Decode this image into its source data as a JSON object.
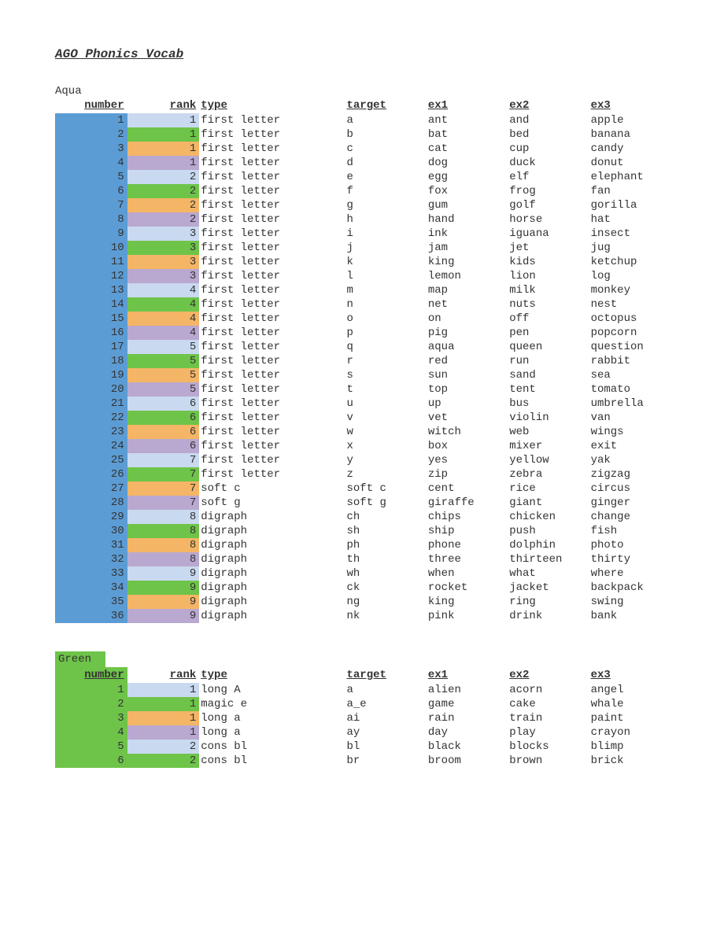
{
  "title": "AGO Phonics Vocab",
  "sections": [
    {
      "label": "Aqua",
      "num_bg_class": "aqua-bg",
      "headers": [
        "number",
        "rank",
        "type",
        "target",
        "ex1",
        "ex2",
        "ex3"
      ],
      "rows": [
        {
          "n": 1,
          "r": 1,
          "rc": "rank-c1",
          "type": "first letter",
          "target": "a",
          "ex1": "ant",
          "ex2": "and",
          "ex3": "apple"
        },
        {
          "n": 2,
          "r": 1,
          "rc": "rank-c2",
          "type": "first letter",
          "target": "b",
          "ex1": "bat",
          "ex2": "bed",
          "ex3": "banana"
        },
        {
          "n": 3,
          "r": 1,
          "rc": "rank-c3",
          "type": "first letter",
          "target": "c",
          "ex1": "cat",
          "ex2": "cup",
          "ex3": "candy"
        },
        {
          "n": 4,
          "r": 1,
          "rc": "rank-c4",
          "type": "first letter",
          "target": "d",
          "ex1": "dog",
          "ex2": "duck",
          "ex3": "donut"
        },
        {
          "n": 5,
          "r": 2,
          "rc": "rank-c1",
          "type": "first letter",
          "target": "e",
          "ex1": "egg",
          "ex2": "elf",
          "ex3": "elephant"
        },
        {
          "n": 6,
          "r": 2,
          "rc": "rank-c2",
          "type": "first letter",
          "target": "f",
          "ex1": "fox",
          "ex2": "frog",
          "ex3": "fan"
        },
        {
          "n": 7,
          "r": 2,
          "rc": "rank-c3",
          "type": "first letter",
          "target": "g",
          "ex1": "gum",
          "ex2": "golf",
          "ex3": "gorilla"
        },
        {
          "n": 8,
          "r": 2,
          "rc": "rank-c4",
          "type": "first letter",
          "target": "h",
          "ex1": "hand",
          "ex2": "horse",
          "ex3": "hat"
        },
        {
          "n": 9,
          "r": 3,
          "rc": "rank-c1",
          "type": "first letter",
          "target": "i",
          "ex1": "ink",
          "ex2": "iguana",
          "ex3": "insect"
        },
        {
          "n": 10,
          "r": 3,
          "rc": "rank-c2",
          "type": "first letter",
          "target": "j",
          "ex1": "jam",
          "ex2": "jet",
          "ex3": "jug"
        },
        {
          "n": 11,
          "r": 3,
          "rc": "rank-c3",
          "type": "first letter",
          "target": "k",
          "ex1": "king",
          "ex2": "kids",
          "ex3": "ketchup"
        },
        {
          "n": 12,
          "r": 3,
          "rc": "rank-c4",
          "type": "first letter",
          "target": "l",
          "ex1": "lemon",
          "ex2": "lion",
          "ex3": "log"
        },
        {
          "n": 13,
          "r": 4,
          "rc": "rank-c1",
          "type": "first letter",
          "target": "m",
          "ex1": "map",
          "ex2": "milk",
          "ex3": "monkey"
        },
        {
          "n": 14,
          "r": 4,
          "rc": "rank-c2",
          "type": "first letter",
          "target": "n",
          "ex1": "net",
          "ex2": "nuts",
          "ex3": "nest"
        },
        {
          "n": 15,
          "r": 4,
          "rc": "rank-c3",
          "type": "first letter",
          "target": "o",
          "ex1": "on",
          "ex2": "off",
          "ex3": "octopus"
        },
        {
          "n": 16,
          "r": 4,
          "rc": "rank-c4",
          "type": "first letter",
          "target": "p",
          "ex1": "pig",
          "ex2": "pen",
          "ex3": "popcorn"
        },
        {
          "n": 17,
          "r": 5,
          "rc": "rank-c1",
          "type": "first letter",
          "target": "q",
          "ex1": "aqua",
          "ex2": "queen",
          "ex3": "question"
        },
        {
          "n": 18,
          "r": 5,
          "rc": "rank-c2",
          "type": "first letter",
          "target": "r",
          "ex1": "red",
          "ex2": "run",
          "ex3": "rabbit"
        },
        {
          "n": 19,
          "r": 5,
          "rc": "rank-c3",
          "type": "first letter",
          "target": "s",
          "ex1": "sun",
          "ex2": "sand",
          "ex3": "sea"
        },
        {
          "n": 20,
          "r": 5,
          "rc": "rank-c4",
          "type": "first letter",
          "target": "t",
          "ex1": "top",
          "ex2": "tent",
          "ex3": "tomato"
        },
        {
          "n": 21,
          "r": 6,
          "rc": "rank-c1",
          "type": "first letter",
          "target": "u",
          "ex1": "up",
          "ex2": "bus",
          "ex3": "umbrella"
        },
        {
          "n": 22,
          "r": 6,
          "rc": "rank-c2",
          "type": "first letter",
          "target": "v",
          "ex1": "vet",
          "ex2": "violin",
          "ex3": "van"
        },
        {
          "n": 23,
          "r": 6,
          "rc": "rank-c3",
          "type": "first letter",
          "target": "w",
          "ex1": "witch",
          "ex2": "web",
          "ex3": "wings"
        },
        {
          "n": 24,
          "r": 6,
          "rc": "rank-c4",
          "type": "first letter",
          "target": "x",
          "ex1": "box",
          "ex2": "mixer",
          "ex3": "exit"
        },
        {
          "n": 25,
          "r": 7,
          "rc": "rank-c1",
          "type": "first letter",
          "target": "y",
          "ex1": "yes",
          "ex2": "yellow",
          "ex3": "yak"
        },
        {
          "n": 26,
          "r": 7,
          "rc": "rank-c2",
          "type": "first letter",
          "target": "z",
          "ex1": "zip",
          "ex2": "zebra",
          "ex3": "zigzag"
        },
        {
          "n": 27,
          "r": 7,
          "rc": "rank-c3",
          "type": "soft c",
          "target": "soft c",
          "ex1": "cent",
          "ex2": "rice",
          "ex3": "circus"
        },
        {
          "n": 28,
          "r": 7,
          "rc": "rank-c4",
          "type": "soft g",
          "target": "soft g",
          "ex1": "giraffe",
          "ex2": "giant",
          "ex3": "ginger"
        },
        {
          "n": 29,
          "r": 8,
          "rc": "rank-c1",
          "type": "digraph",
          "target": "ch",
          "ex1": "chips",
          "ex2": "chicken",
          "ex3": "change"
        },
        {
          "n": 30,
          "r": 8,
          "rc": "rank-c2",
          "type": "digraph",
          "target": "sh",
          "ex1": "ship",
          "ex2": "push",
          "ex3": "fish"
        },
        {
          "n": 31,
          "r": 8,
          "rc": "rank-c3",
          "type": "digraph",
          "target": "ph",
          "ex1": "phone",
          "ex2": "dolphin",
          "ex3": "photo"
        },
        {
          "n": 32,
          "r": 8,
          "rc": "rank-c4",
          "type": "digraph",
          "target": "th",
          "ex1": "three",
          "ex2": "thirteen",
          "ex3": "thirty"
        },
        {
          "n": 33,
          "r": 9,
          "rc": "rank-c1",
          "type": "digraph",
          "target": "wh",
          "ex1": "when",
          "ex2": "what",
          "ex3": "where"
        },
        {
          "n": 34,
          "r": 9,
          "rc": "rank-c2",
          "type": "digraph",
          "target": "ck",
          "ex1": "rocket",
          "ex2": "jacket",
          "ex3": "backpack"
        },
        {
          "n": 35,
          "r": 9,
          "rc": "rank-c3",
          "type": "digraph",
          "target": "ng",
          "ex1": "king",
          "ex2": "ring",
          "ex3": "swing"
        },
        {
          "n": 36,
          "r": 9,
          "rc": "rank-c4",
          "type": "digraph",
          "target": "nk",
          "ex1": "pink",
          "ex2": "drink",
          "ex3": "bank"
        }
      ]
    },
    {
      "label": "Green",
      "num_bg_class": "green-bg",
      "headers": [
        "number",
        "rank",
        "type",
        "target",
        "ex1",
        "ex2",
        "ex3"
      ],
      "rows": [
        {
          "n": 1,
          "r": 1,
          "rc": "rank-c1",
          "type": "long A",
          "target": "a",
          "ex1": "alien",
          "ex2": "acorn",
          "ex3": "angel"
        },
        {
          "n": 2,
          "r": 1,
          "rc": "rank-c2",
          "type": "magic e",
          "target": "a_e",
          "ex1": "game",
          "ex2": "cake",
          "ex3": "whale"
        },
        {
          "n": 3,
          "r": 1,
          "rc": "rank-c3",
          "type": "long a",
          "target": "ai",
          "ex1": "rain",
          "ex2": "train",
          "ex3": "paint"
        },
        {
          "n": 4,
          "r": 1,
          "rc": "rank-c4",
          "type": "long a",
          "target": "ay",
          "ex1": "day",
          "ex2": "play",
          "ex3": "crayon"
        },
        {
          "n": 5,
          "r": 2,
          "rc": "rank-c1",
          "type": "cons bl",
          "target": "bl",
          "ex1": "black",
          "ex2": "blocks",
          "ex3": "blimp"
        },
        {
          "n": 6,
          "r": 2,
          "rc": "rank-c2",
          "type": "cons bl",
          "target": "br",
          "ex1": "broom",
          "ex2": "brown",
          "ex3": "brick"
        }
      ]
    }
  ]
}
